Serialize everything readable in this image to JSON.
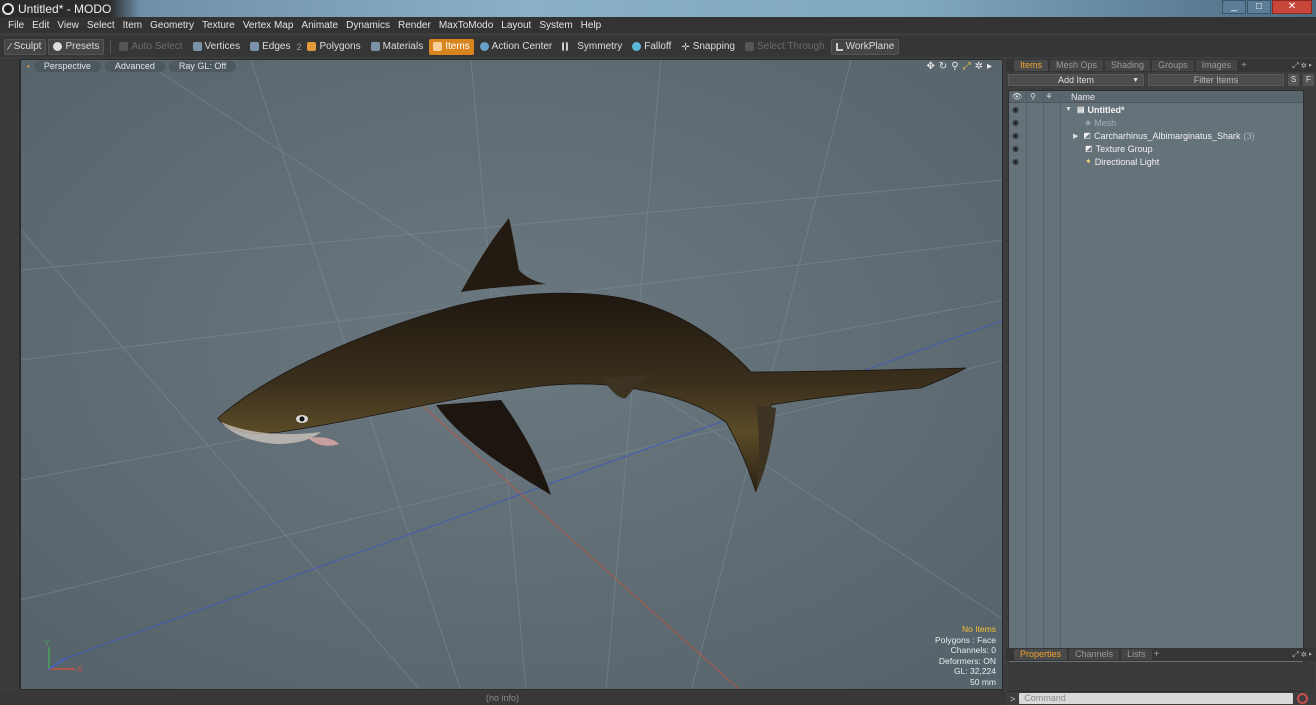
{
  "window": {
    "title": "Untitled* - MODO",
    "minimize": "_",
    "maximize": "□",
    "close": "✕"
  },
  "menu": [
    "File",
    "Edit",
    "View",
    "Select",
    "Item",
    "Geometry",
    "Texture",
    "Vertex Map",
    "Animate",
    "Dynamics",
    "Render",
    "MaxToModo",
    "Layout",
    "System",
    "Help"
  ],
  "toolbar": {
    "sculpt": "Sculpt",
    "presets": "Presets",
    "auto_select": "Auto Select",
    "vertices": "Vertices",
    "edges": "Edges",
    "edges_count": "2",
    "polygons": "Polygons",
    "materials": "Materials",
    "items": "Items",
    "action_center": "Action Center",
    "symmetry": "Symmetry",
    "falloff": "Falloff",
    "snapping": "Snapping",
    "select_through": "Select Through",
    "workplane": "WorkPlane"
  },
  "viewport": {
    "tabs": [
      "Perspective",
      "Advanced",
      "Ray GL: Off"
    ],
    "stats": {
      "selection": "No Items",
      "polygons": "Polygons : Face",
      "channels": "Channels: 0",
      "deformers": "Deformers: ON",
      "gl": "GL: 32,224",
      "size": "50 mm"
    },
    "axis": {
      "x": "X",
      "y": "Y"
    }
  },
  "status": {
    "info": "(no info)"
  },
  "items_panel": {
    "tabs": [
      "Items",
      "Mesh Ops",
      "Shading",
      "Groups",
      "Images"
    ],
    "add_item": "Add Item",
    "filter_placeholder": "Filter Items",
    "s_button": "S",
    "f_button": "F",
    "name_header": "Name",
    "rows": [
      {
        "label": "Untitled*",
        "count": ""
      },
      {
        "label": "Mesh",
        "count": ""
      },
      {
        "label": "Carcharhinus_Albimarginatus_Shark",
        "count": "(3)"
      },
      {
        "label": "Texture Group",
        "count": ""
      },
      {
        "label": "Directional Light",
        "count": ""
      }
    ]
  },
  "properties_panel": {
    "tabs": [
      "Properties",
      "Channels",
      "Lists"
    ]
  },
  "command": {
    "prompt": ">",
    "placeholder": "Command"
  },
  "colors": {
    "accent": "#d9851f",
    "viewport_bg": "#5d6a72",
    "shark_body": "#2a2117"
  }
}
